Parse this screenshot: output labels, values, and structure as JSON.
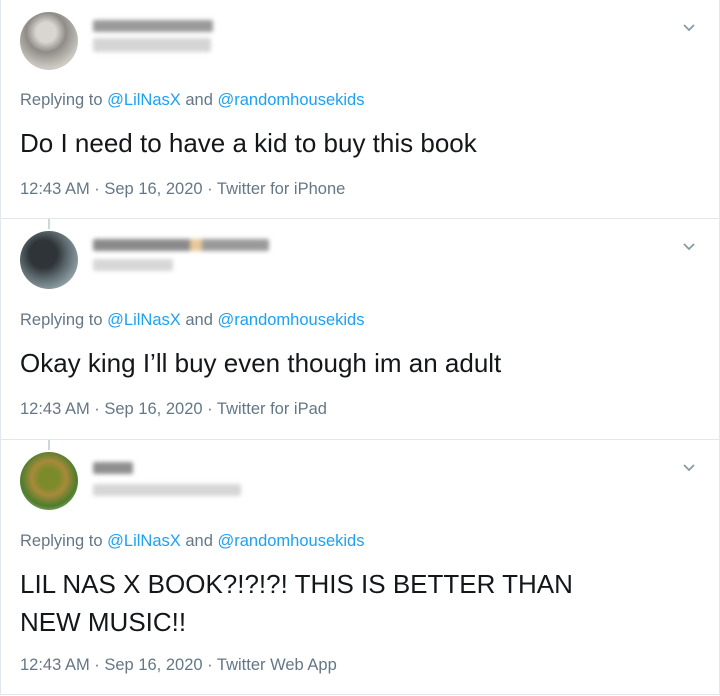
{
  "tweets": [
    {
      "reply_prefix": "Replying to",
      "mention1": "@LilNasX",
      "and": "and",
      "mention2": "@randomhousekids",
      "text": "Do I need to have a kid to buy this book",
      "meta": "12:43 AM · Sep 16, 2020 · Twitter for iPhone"
    },
    {
      "reply_prefix": "Replying to",
      "mention1": "@LilNasX",
      "and": "and",
      "mention2": "@randomhousekids",
      "text": "Okay king I’ll buy even though im an adult",
      "meta": "12:43 AM · Sep 16, 2020 · Twitter for iPad"
    },
    {
      "reply_prefix": "Replying to",
      "mention1": "@LilNasX",
      "and": "and",
      "mention2": "@randomhousekids",
      "text": "LIL NAS X BOOK?!?!?! THIS IS BETTER THAN NEW MUSIC!!",
      "meta": "12:43 AM · Sep 16, 2020 · Twitter Web App"
    }
  ],
  "icons": {
    "menu": "chevron-down-icon"
  },
  "colors": {
    "link": "#1da1f2",
    "secondary_text": "#657786",
    "primary_text": "#14171a",
    "border": "#e1e8ed"
  }
}
